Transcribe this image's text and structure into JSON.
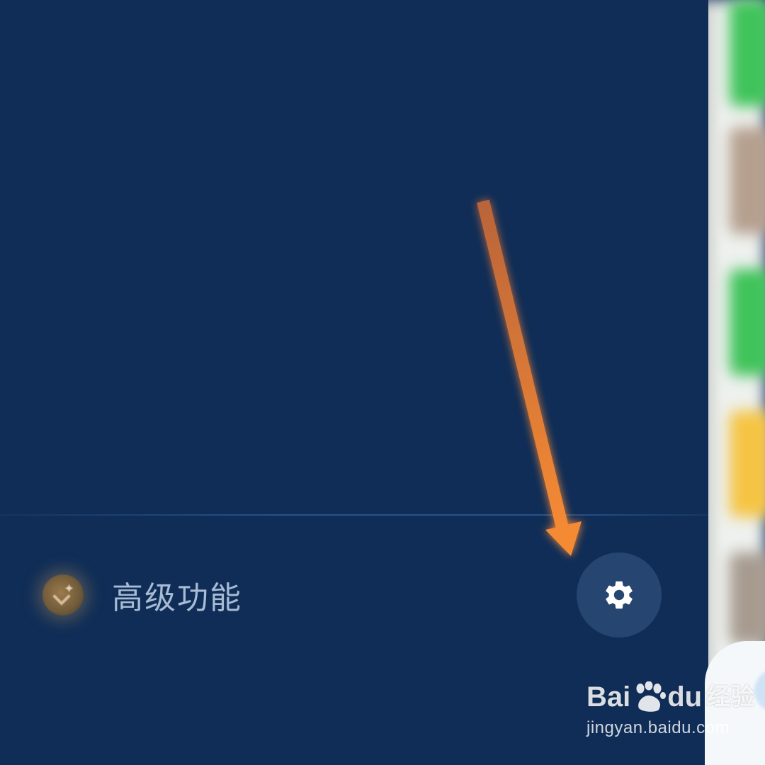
{
  "drawer": {
    "premium_label": "高级功能",
    "settings_icon": "gear-icon",
    "premium_icon": "vip-badge-icon"
  },
  "colors": {
    "drawer_background": "#0f2d57",
    "settings_button_background": "#274571",
    "arrow": "#f28a36",
    "premium_label": "#a8bbd4"
  },
  "watermark": {
    "brand_left": "Bai",
    "brand_du": "du",
    "brand_cn": "经验",
    "url": "jingyan.baidu.com"
  }
}
